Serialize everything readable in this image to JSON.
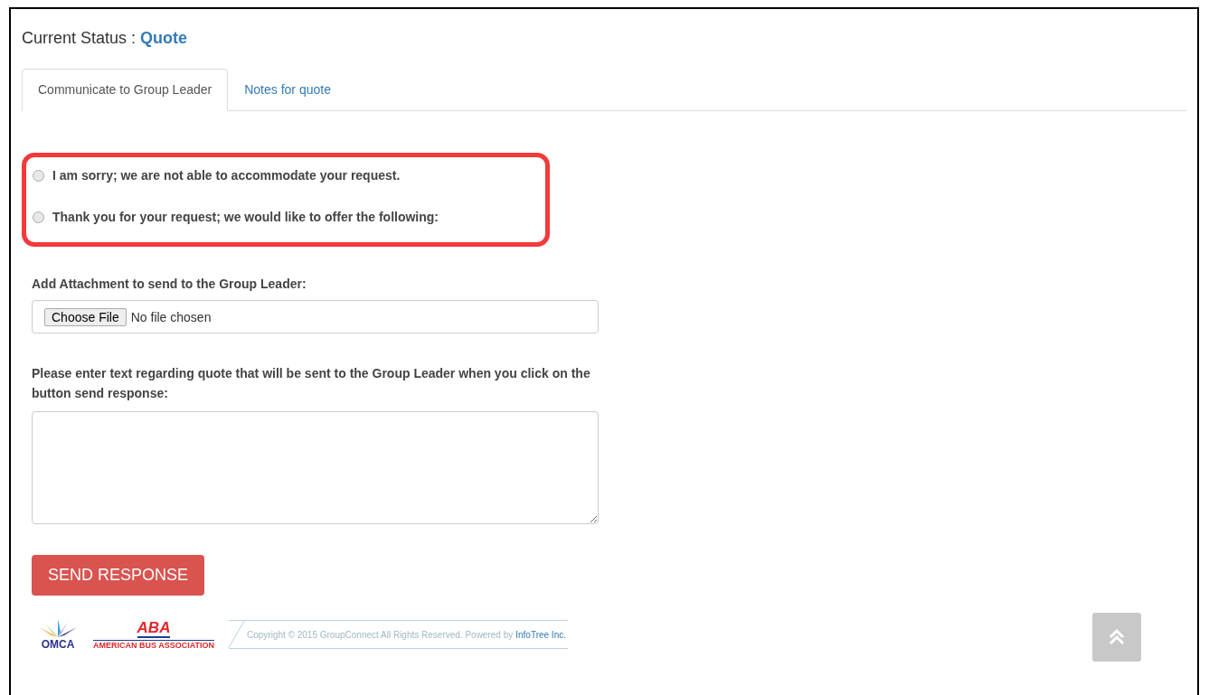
{
  "status": {
    "label": "Current Status :",
    "value": "Quote"
  },
  "tabs": [
    {
      "label": "Communicate to Group Leader",
      "selected": true
    },
    {
      "label": "Notes for quote",
      "selected": false
    }
  ],
  "options": [
    {
      "label": "I am sorry; we are not able to accommodate your request.",
      "selected": false
    },
    {
      "label": "Thank you for your request; we would like to offer the following:",
      "selected": false
    }
  ],
  "attachment": {
    "label": "Add Attachment to send to the Group Leader:",
    "button": "Choose File",
    "value": "No file chosen"
  },
  "message": {
    "label": "Please enter text regarding quote that will be sent to the Group Leader when you click on the button send response:"
  },
  "send_button": "SEND RESPONSE",
  "footer": {
    "logo_1": "OMCA",
    "logo_2": "ABA",
    "logo_2_caption": "AMERICAN BUS ASSOCIATION",
    "copyright": "Copyright © 2015 GroupConnect All Rights Reserved. Powered by",
    "link": "InfoTree Inc."
  }
}
